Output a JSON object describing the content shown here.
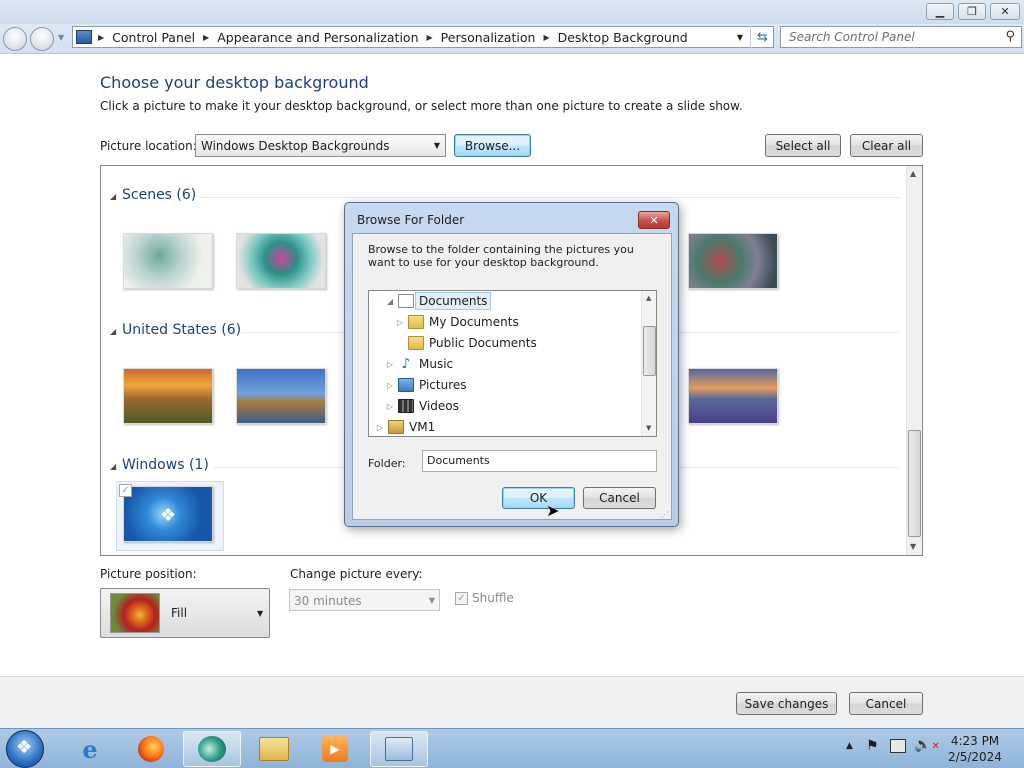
{
  "window": {
    "minimize": "▭",
    "maximize": "⧉",
    "close": "✕"
  },
  "nav": {
    "back_icon": "arrow-left",
    "forward_icon": "arrow-right",
    "breadcrumb": [
      "Control Panel",
      "Appearance and Personalization",
      "Personalization",
      "Desktop Background"
    ],
    "search_placeholder": "Search Control Panel"
  },
  "main": {
    "title": "Choose your desktop background",
    "subtitle": "Click a picture to make it your desktop background, or select more than one picture to create a slide show.",
    "picture_location_label": "Picture location:",
    "picture_location_value": "Windows Desktop Backgrounds",
    "browse_label": "Browse...",
    "select_all_label": "Select all",
    "clear_all_label": "Clear all"
  },
  "groups": [
    {
      "title": "Scenes (6)"
    },
    {
      "title": "United States (6)"
    },
    {
      "title": "Windows (1)"
    }
  ],
  "bottom": {
    "position_label": "Picture position:",
    "position_value": "Fill",
    "change_label": "Change picture every:",
    "change_value": "30 minutes",
    "shuffle_label": "Shuffle",
    "save_label": "Save changes",
    "cancel_label": "Cancel"
  },
  "dialog": {
    "title": "Browse For Folder",
    "instructions": "Browse to the folder containing the pictures you want to use for your desktop background.",
    "tree": [
      "Documents",
      "My Documents",
      "Public Documents",
      "Music",
      "Pictures",
      "Videos",
      "VM1"
    ],
    "folder_label": "Folder:",
    "folder_value": "Documents",
    "ok_label": "OK",
    "cancel_label": "Cancel"
  },
  "taskbar": {
    "items": [
      "start",
      "internet-explorer",
      "firefox",
      "media-center",
      "explorer",
      "media-player",
      "control-panel"
    ],
    "time": "4:23 PM",
    "date": "2/5/2024"
  },
  "colors": {
    "title_blue": "#1e3f8a",
    "taskbar": "#9dbfe0",
    "selection": "#e4eef9"
  }
}
